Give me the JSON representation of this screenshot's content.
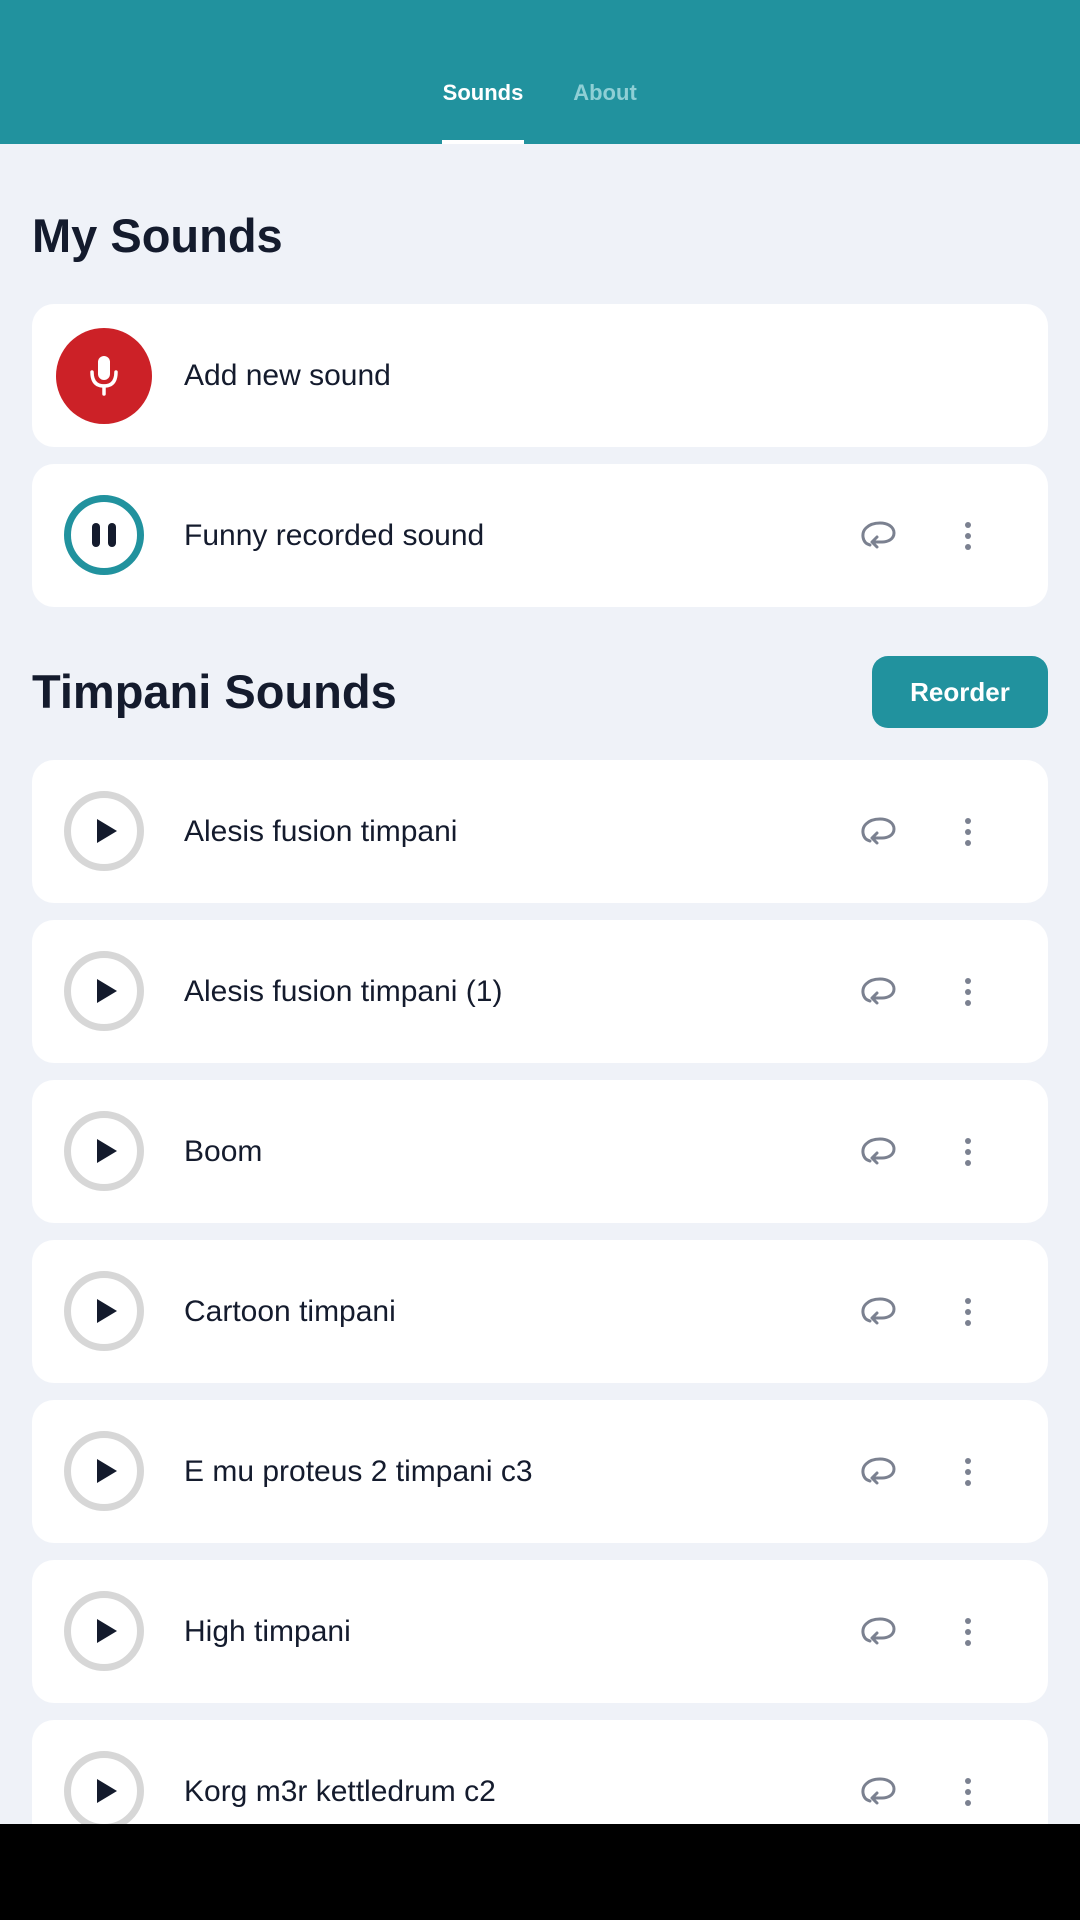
{
  "tabs": [
    {
      "label": "Sounds",
      "active": true
    },
    {
      "label": "About",
      "active": false
    }
  ],
  "my_sounds": {
    "title": "My Sounds",
    "add_label": "Add new sound",
    "items": [
      {
        "label": "Funny recorded sound",
        "state": "playing"
      }
    ]
  },
  "timpani": {
    "title": "Timpani Sounds",
    "reorder_label": "Reorder",
    "items": [
      {
        "label": "Alesis fusion timpani"
      },
      {
        "label": "Alesis fusion timpani (1)"
      },
      {
        "label": "Boom"
      },
      {
        "label": "Cartoon timpani"
      },
      {
        "label": "E mu proteus 2 timpani c3"
      },
      {
        "label": "High timpani"
      },
      {
        "label": "Korg m3r kettledrum c2"
      }
    ]
  },
  "icons": {
    "mic": "microphone-icon",
    "play": "play-icon",
    "pause": "pause-icon",
    "loop": "loop-icon",
    "more": "more-vertical-icon"
  },
  "colors": {
    "accent": "#21929e",
    "record": "#cc2127",
    "background": "#eff2f8",
    "text": "#141b2d"
  }
}
